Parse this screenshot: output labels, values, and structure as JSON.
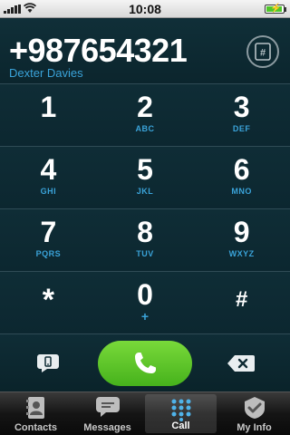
{
  "status_bar": {
    "time": "10:08",
    "battery_level": 0.85,
    "battery_charging": true,
    "icons": [
      "signal-icon",
      "wifi-icon",
      "battery-icon"
    ]
  },
  "display": {
    "number": "+987654321",
    "contact_name": "Dexter Davies",
    "toggle_icon": "hash-keypad-icon"
  },
  "keypad": {
    "keys": [
      {
        "digit": "1",
        "letters": ""
      },
      {
        "digit": "2",
        "letters": "ABC"
      },
      {
        "digit": "3",
        "letters": "DEF"
      },
      {
        "digit": "4",
        "letters": "GHI"
      },
      {
        "digit": "5",
        "letters": "JKL"
      },
      {
        "digit": "6",
        "letters": "MNO"
      },
      {
        "digit": "7",
        "letters": "PQRS"
      },
      {
        "digit": "8",
        "letters": "TUV"
      },
      {
        "digit": "9",
        "letters": "WXYZ"
      },
      {
        "digit": "*",
        "letters": ""
      },
      {
        "digit": "0",
        "letters": "+"
      },
      {
        "digit": "#",
        "letters": ""
      }
    ]
  },
  "actions": {
    "message_icon": "message-icon",
    "call_icon": "phone-icon",
    "backspace_icon": "backspace-icon"
  },
  "tabs": [
    {
      "label": "Contacts",
      "icon": "contacts-icon",
      "active": false
    },
    {
      "label": "Messages",
      "icon": "messages-icon",
      "active": false
    },
    {
      "label": "Call",
      "icon": "keypad-icon",
      "active": true
    },
    {
      "label": "My Info",
      "icon": "my-info-icon",
      "active": false
    }
  ],
  "colors": {
    "background": "#0e2a33",
    "accent_blue": "#3aa3d9",
    "call_green": "#4fc72a"
  }
}
